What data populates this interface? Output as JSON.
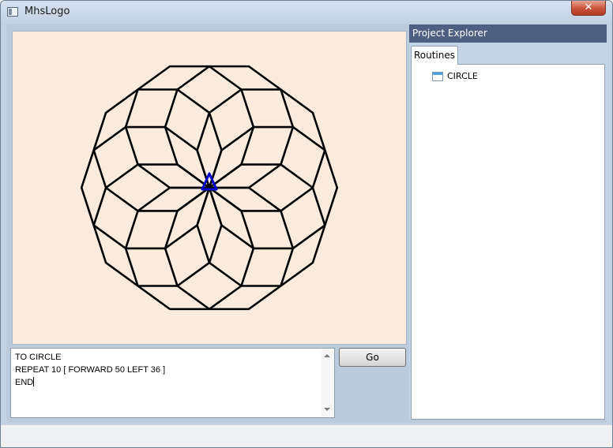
{
  "window": {
    "title": "MhsLogo",
    "close_glyph": "✕"
  },
  "canvas": {
    "background": "#faebdc",
    "line_color": "#000000",
    "turtle_color": "#0000cc"
  },
  "editor": {
    "lines": [
      "TO CIRCLE",
      "REPEAT 10 [ FORWARD 50 LEFT 36 ]",
      "END"
    ]
  },
  "toolbar": {
    "go_label": "Go"
  },
  "project_explorer": {
    "title": "Project Explorer",
    "tabs": [
      {
        "label": "Routines"
      }
    ],
    "routines": [
      {
        "label": "CIRCLE",
        "icon": "routine-icon"
      }
    ]
  },
  "status_bar": {
    "text": ""
  }
}
